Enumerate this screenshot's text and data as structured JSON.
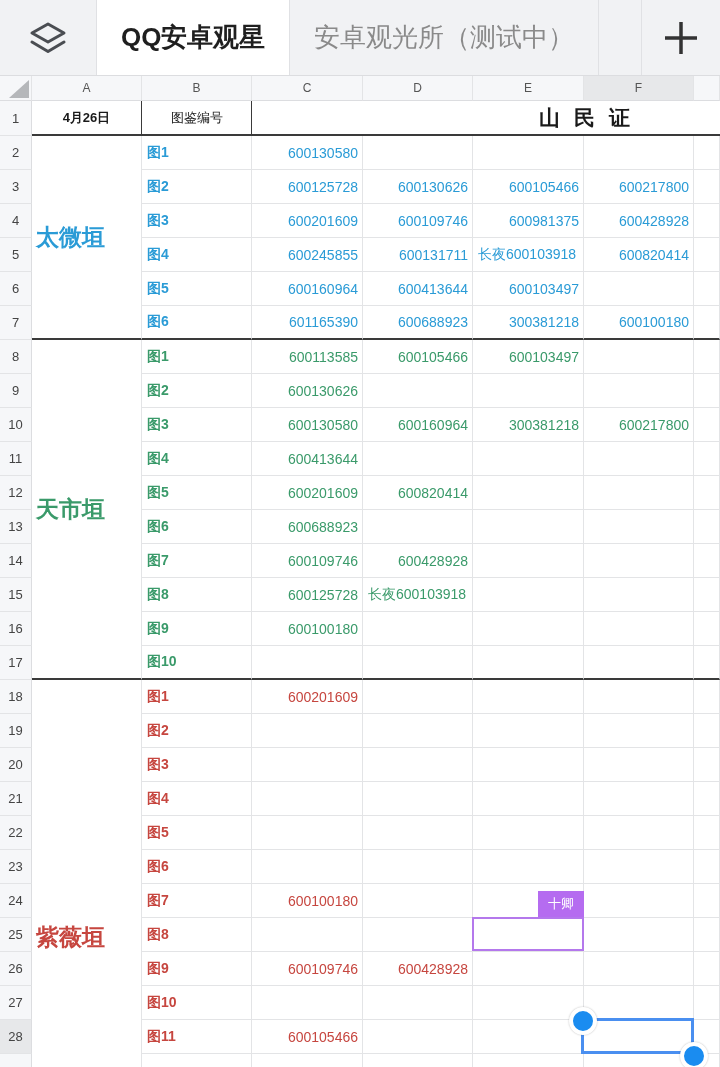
{
  "toolbar": {
    "tabs": [
      {
        "label": "QQ安卓观星",
        "selected": true
      },
      {
        "label": "安卓观光所（测试中）",
        "selected": false
      }
    ]
  },
  "sheet": {
    "columns": [
      {
        "label": "A",
        "selected": false
      },
      {
        "label": "B",
        "selected": false
      },
      {
        "label": "C",
        "selected": false
      },
      {
        "label": "D",
        "selected": false
      },
      {
        "label": "E",
        "selected": false
      },
      {
        "label": "F",
        "selected": true
      }
    ],
    "title_row": {
      "number": "1",
      "selected": false,
      "date": "4月26日",
      "heading": "图鉴编号",
      "title": "山 民 证"
    },
    "groups": [
      {
        "label": "太微垣",
        "color": "#2a9bd6",
        "rows": [
          {
            "number": "2",
            "selected": false,
            "item": "图1",
            "cells": [
              {
                "kind": "number",
                "text": "600130580"
              }
            ]
          },
          {
            "number": "3",
            "selected": false,
            "item": "图2",
            "cells": [
              {
                "kind": "number",
                "text": "600125728"
              },
              {
                "kind": "number",
                "text": "600130626"
              },
              {
                "kind": "number",
                "text": "600105466"
              },
              {
                "kind": "number",
                "text": "600217800"
              }
            ]
          },
          {
            "number": "4",
            "selected": false,
            "item": "图3",
            "cells": [
              {
                "kind": "number",
                "text": "600201609"
              },
              {
                "kind": "number",
                "text": "600109746"
              },
              {
                "kind": "number",
                "text": "600981375"
              },
              {
                "kind": "number",
                "text": "600428928"
              }
            ]
          },
          {
            "number": "5",
            "selected": false,
            "item": "图4",
            "cells": [
              {
                "kind": "number",
                "text": "600245855"
              },
              {
                "kind": "number",
                "text": "600131711"
              },
              {
                "kind": "text",
                "text": "长夜600103918"
              },
              {
                "kind": "number",
                "text": "600820414"
              }
            ]
          },
          {
            "number": "6",
            "selected": false,
            "item": "图5",
            "cells": [
              {
                "kind": "number",
                "text": "600160964"
              },
              {
                "kind": "number",
                "text": "600413644"
              },
              {
                "kind": "number",
                "text": "600103497"
              }
            ]
          },
          {
            "number": "7",
            "selected": false,
            "item": "图6",
            "cells": [
              {
                "kind": "number",
                "text": "601165390"
              },
              {
                "kind": "number",
                "text": "600688923"
              },
              {
                "kind": "number",
                "text": "300381218"
              },
              {
                "kind": "number",
                "text": "600100180"
              }
            ]
          }
        ]
      },
      {
        "label": "天市垣",
        "color": "#3a9a6a",
        "rows": [
          {
            "number": "8",
            "selected": false,
            "item": "图1",
            "cells": [
              {
                "kind": "number",
                "text": "600113585"
              },
              {
                "kind": "number",
                "text": "600105466"
              },
              {
                "kind": "number",
                "text": "600103497"
              }
            ]
          },
          {
            "number": "9",
            "selected": false,
            "item": "图2",
            "cells": [
              {
                "kind": "number",
                "text": "600130626"
              }
            ]
          },
          {
            "number": "10",
            "selected": false,
            "item": "图3",
            "cells": [
              {
                "kind": "number",
                "text": "600130580"
              },
              {
                "kind": "number",
                "text": "600160964"
              },
              {
                "kind": "number",
                "text": "300381218"
              },
              {
                "kind": "number",
                "text": "600217800"
              }
            ]
          },
          {
            "number": "11",
            "selected": false,
            "item": "图4",
            "cells": [
              {
                "kind": "number",
                "text": "600413644"
              }
            ]
          },
          {
            "number": "12",
            "selected": false,
            "item": "图5",
            "cells": [
              {
                "kind": "number",
                "text": "600201609"
              },
              {
                "kind": "number",
                "text": "600820414"
              }
            ]
          },
          {
            "number": "13",
            "selected": false,
            "item": "图6",
            "cells": [
              {
                "kind": "number",
                "text": "600688923"
              }
            ]
          },
          {
            "number": "14",
            "selected": false,
            "item": "图7",
            "cells": [
              {
                "kind": "number",
                "text": "600109746"
              },
              {
                "kind": "number",
                "text": "600428928"
              }
            ]
          },
          {
            "number": "15",
            "selected": false,
            "item": "图8",
            "cells": [
              {
                "kind": "number",
                "text": "600125728"
              },
              {
                "kind": "text",
                "text": "长夜600103918"
              }
            ]
          },
          {
            "number": "16",
            "selected": false,
            "item": "图9",
            "cells": [
              {
                "kind": "number",
                "text": "600100180"
              }
            ]
          },
          {
            "number": "17",
            "selected": false,
            "item": "图10",
            "cells": []
          }
        ]
      },
      {
        "label": "紫薇垣",
        "color": "#c6463f",
        "rows": [
          {
            "number": "18",
            "selected": false,
            "item": "图1",
            "cells": [
              {
                "kind": "number",
                "text": "600201609"
              }
            ]
          },
          {
            "number": "19",
            "selected": false,
            "item": "图2",
            "cells": []
          },
          {
            "number": "20",
            "selected": false,
            "item": "图3",
            "cells": []
          },
          {
            "number": "21",
            "selected": false,
            "item": "图4",
            "cells": []
          },
          {
            "number": "22",
            "selected": false,
            "item": "图5",
            "cells": []
          },
          {
            "number": "23",
            "selected": false,
            "item": "图6",
            "cells": []
          },
          {
            "number": "24",
            "selected": false,
            "item": "图7",
            "cells": [
              {
                "kind": "number",
                "text": "600100180"
              }
            ]
          },
          {
            "number": "25",
            "selected": false,
            "item": "图8",
            "cells": [
              {
                "kind": "empty"
              },
              {
                "kind": "empty"
              },
              {
                "kind": "empty",
                "collaborator": "十卿"
              }
            ]
          },
          {
            "number": "26",
            "selected": false,
            "item": "图9",
            "cells": [
              {
                "kind": "number",
                "text": "600109746"
              },
              {
                "kind": "number",
                "text": "600428928"
              }
            ]
          },
          {
            "number": "27",
            "selected": false,
            "item": "图10",
            "cells": []
          },
          {
            "number": "28",
            "selected": true,
            "item": "图11",
            "cells": [
              {
                "kind": "number",
                "text": "600105466"
              }
            ]
          }
        ]
      }
    ]
  }
}
